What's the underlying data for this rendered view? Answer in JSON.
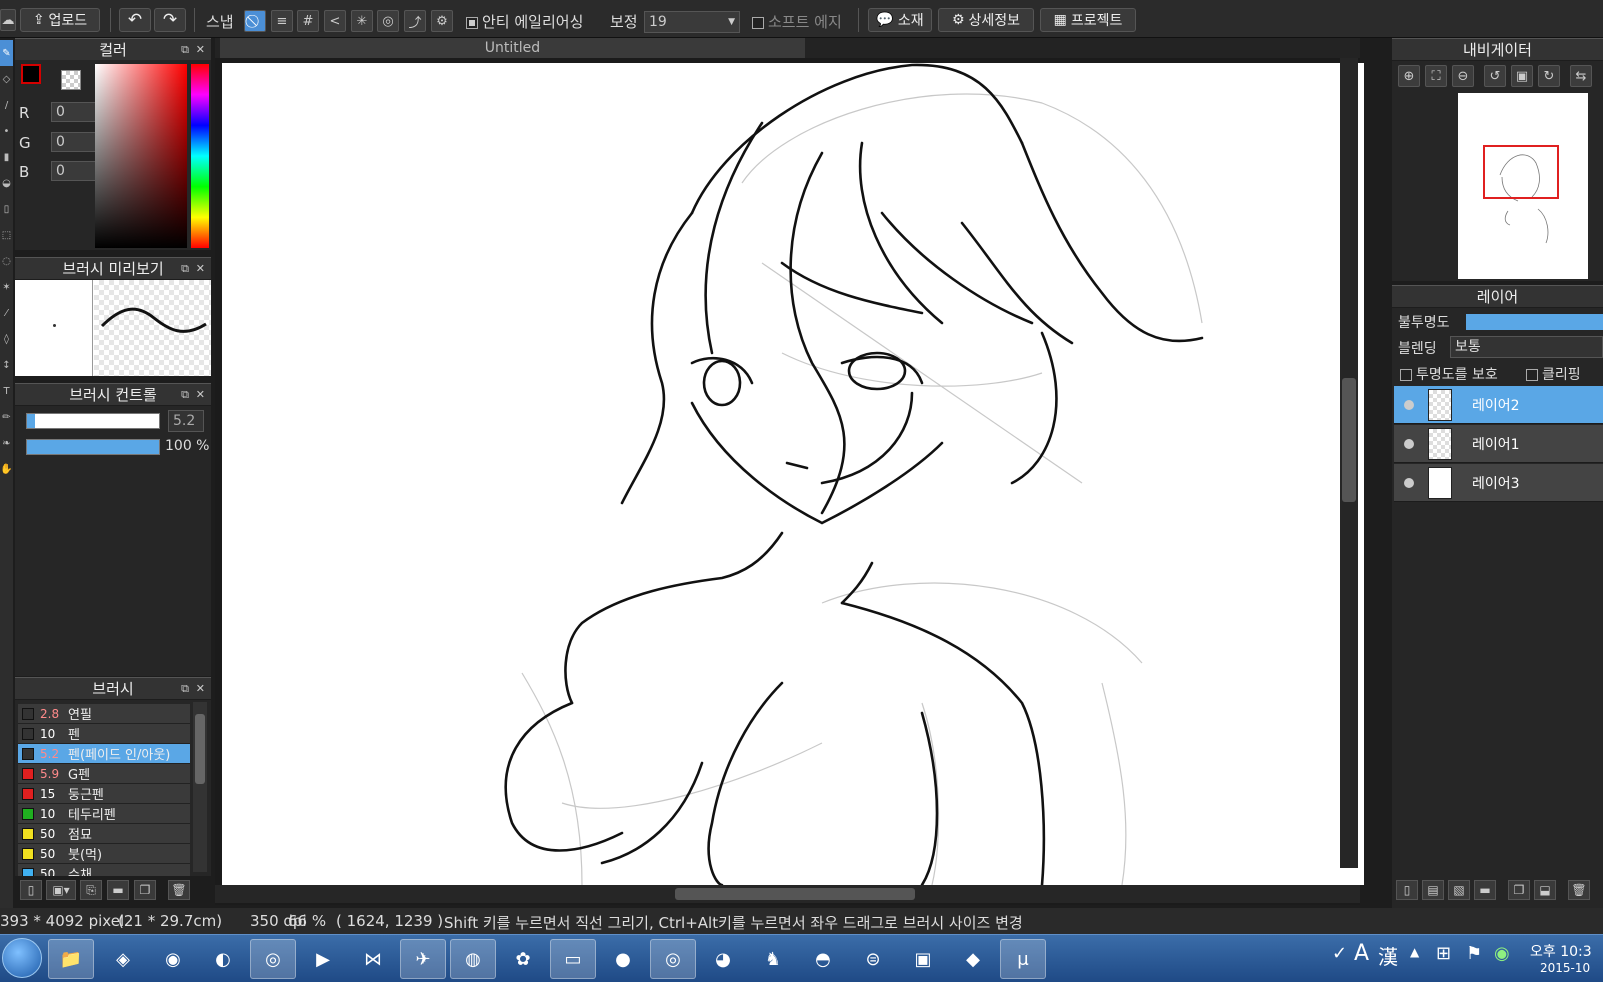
{
  "toolbar": {
    "upload_label": "업로드",
    "snap_label": "스냅",
    "antialias_label": "안티 에일리어싱",
    "correction_label": "보정",
    "correction_value": "19",
    "soft_edge_label": "소프트 에지",
    "material_label": "소재",
    "details_label": "상세정보",
    "project_label": "프로젝트"
  },
  "canvas": {
    "title": "Untitled"
  },
  "color_panel": {
    "title": "컬러",
    "r_label": "R",
    "r_value": "0",
    "g_label": "G",
    "g_value": "0",
    "b_label": "B",
    "b_value": "0",
    "fg_color": "#000000",
    "accent": "#d40000"
  },
  "brush_preview_panel": {
    "title": "브러시 미리보기"
  },
  "brush_control_panel": {
    "title": "브러시 컨트롤",
    "size_value": "5.2",
    "opacity_value": "100 %",
    "size_fraction": 0.05,
    "opacity_fraction": 1.0
  },
  "brush_panel": {
    "title": "브러시",
    "items": [
      {
        "size": "2.8",
        "name": "연필",
        "color": "#333333",
        "size_color": "#ff8a8a"
      },
      {
        "size": "10",
        "name": "펜",
        "color": "#333333",
        "size_color": "#ffffff"
      },
      {
        "size": "5.2",
        "name": "펜(페이드 인/아웃)",
        "color": "#333333",
        "size_color": "#ff8a8a"
      },
      {
        "size": "5.9",
        "name": "G펜",
        "color": "#e02020",
        "size_color": "#ff8a8a"
      },
      {
        "size": "15",
        "name": "둥근펜",
        "color": "#e02020",
        "size_color": "#ffffff"
      },
      {
        "size": "10",
        "name": "테두리펜",
        "color": "#20b020",
        "size_color": "#ffffff"
      },
      {
        "size": "50",
        "name": "점묘",
        "color": "#f0e020",
        "size_color": "#ffffff"
      },
      {
        "size": "50",
        "name": "붓(먹)",
        "color": "#f0e020",
        "size_color": "#ffffff"
      },
      {
        "size": "50",
        "name": "수채",
        "color": "#40b0f0",
        "size_color": "#ffffff"
      }
    ],
    "selected_index": 2
  },
  "navigator_panel": {
    "title": "내비게이터"
  },
  "layer_panel": {
    "title": "레이어",
    "opacity_label": "불투명도",
    "blending_label": "블렌딩",
    "blending_value": "보통",
    "protect_label": "투명도를 보호",
    "clipping_label": "클리핑",
    "layers": [
      {
        "name": "레이어2",
        "selected": true
      },
      {
        "name": "레이어1",
        "selected": false
      },
      {
        "name": "레이어3",
        "selected": false
      }
    ]
  },
  "status_bar": {
    "size_text": "393 * 4092 pixel",
    "cm_text": "(21 * 29.7cm)",
    "dpi_text": "350 dpi",
    "zoom_text": "66 %",
    "coord_text": "( 1624, 1239 )",
    "hint_text": "Shift 키를 누르면서 직선 그리기, Ctrl+Alt키를 누르면서 좌우 드래그로 브러시 사이즈 변경"
  },
  "taskbar": {
    "ime_a": "A",
    "ime_han": "漢",
    "clock_ampm": "오후 10:3",
    "clock_date": "2015-10"
  }
}
